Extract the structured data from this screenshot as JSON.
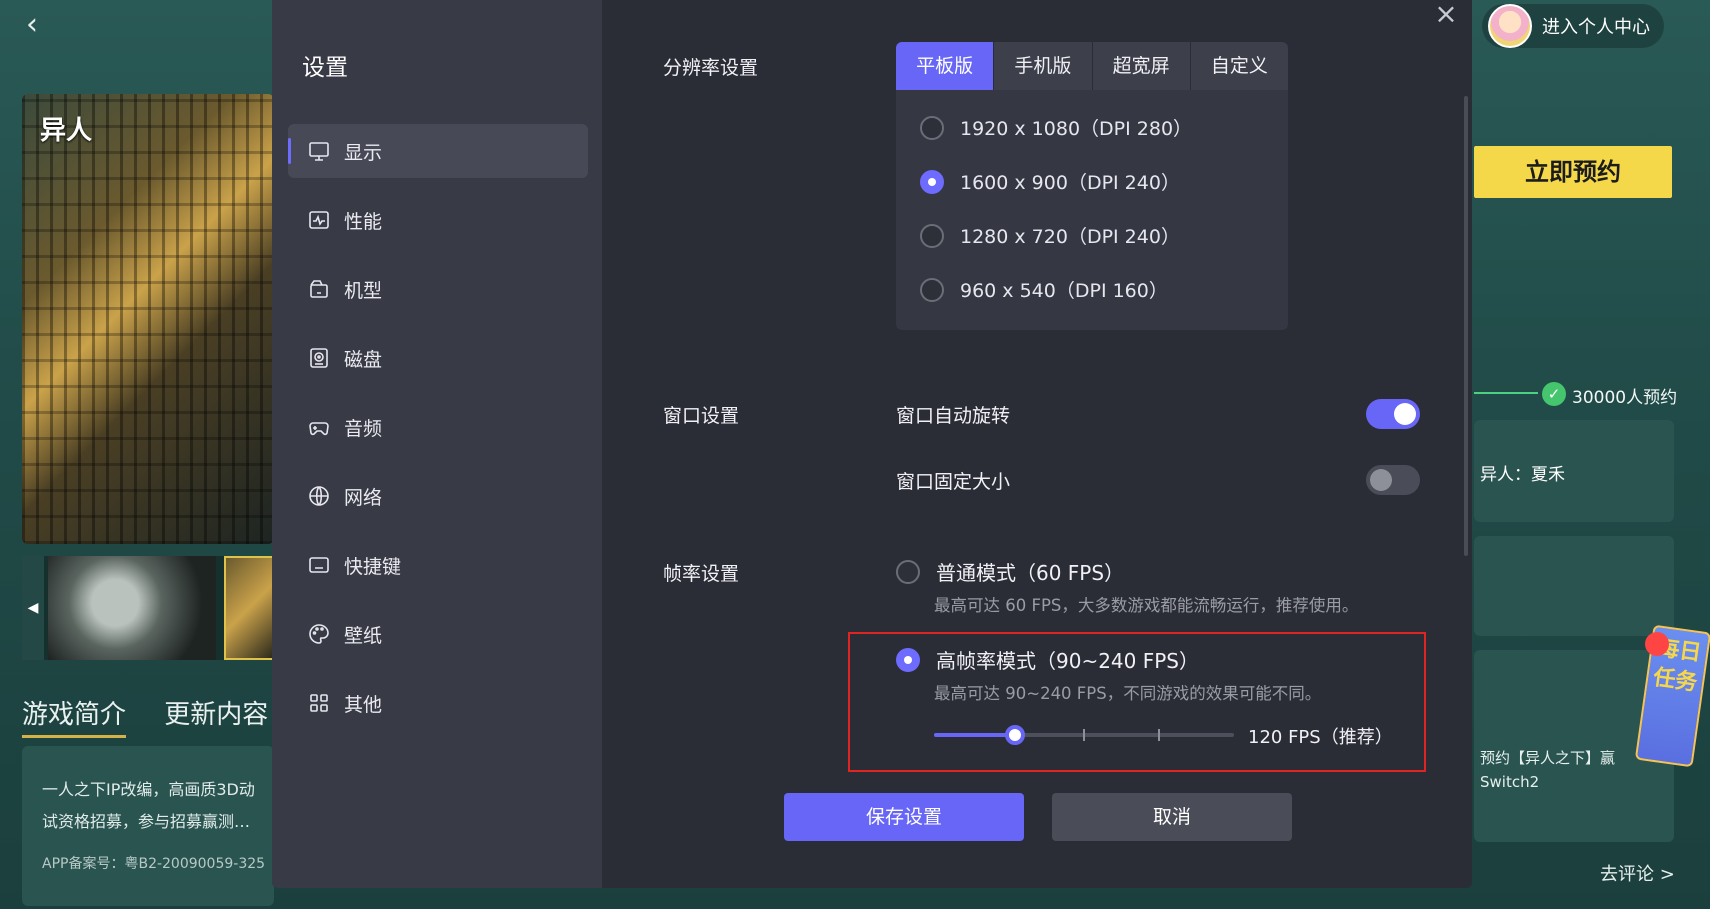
{
  "background": {
    "back_icon": "chevron-left-icon",
    "hero_logo": "异人",
    "intro_tabs": [
      "游戏简介",
      "更新内容"
    ],
    "intro_text_line1": "一人之下IP改编，高画质3D动",
    "intro_text_line2": "试资格招募，参与招募赢测…",
    "intro_license": "APP备案号：粤B2-20090059-325",
    "user_center": "进入个人中心",
    "reserve_button": "立即预约",
    "reserve_count": "30000人预约",
    "panel_r1_text": "异人：夏禾",
    "panel_r3_line1": "预约【异人之下】赢",
    "panel_r3_line2": "Switch2",
    "daily_task": "每日任务",
    "comment_link": "去评论 >"
  },
  "dialog": {
    "title": "设置",
    "close_icon": "close-icon",
    "nav": [
      {
        "label": "显示",
        "icon": "monitor-icon",
        "active": true
      },
      {
        "label": "性能",
        "icon": "performance-icon",
        "active": false
      },
      {
        "label": "机型",
        "icon": "device-icon",
        "active": false
      },
      {
        "label": "磁盘",
        "icon": "disk-icon",
        "active": false
      },
      {
        "label": "音频",
        "icon": "gamepad-icon",
        "active": false
      },
      {
        "label": "网络",
        "icon": "globe-icon",
        "active": false
      },
      {
        "label": "快捷键",
        "icon": "keyboard-icon",
        "active": false
      },
      {
        "label": "壁纸",
        "icon": "palette-icon",
        "active": false
      },
      {
        "label": "其他",
        "icon": "grid-icon",
        "active": false
      }
    ],
    "resolution": {
      "label": "分辨率设置",
      "tabs": [
        "平板版",
        "手机版",
        "超宽屏",
        "自定义"
      ],
      "active_tab": "平板版",
      "options": [
        "1920 x 1080（DPI 280）",
        "1600 x 900（DPI 240）",
        "1280 x 720（DPI 240）",
        "960 x 540（DPI 160）"
      ],
      "selected": "1600 x 900（DPI 240）"
    },
    "window": {
      "label": "窗口设置",
      "auto_rotate": {
        "label": "窗口自动旋转",
        "on": true
      },
      "fixed_size": {
        "label": "窗口固定大小",
        "on": false
      }
    },
    "framerate": {
      "label": "帧率设置",
      "normal": {
        "label": "普通模式（60 FPS）",
        "desc": "最高可达 60 FPS，大多数游戏都能流畅运行，推荐使用。",
        "checked": false
      },
      "high": {
        "label": "高帧率模式（90~240 FPS）",
        "desc": "最高可达 90~240 FPS，不同游戏的效果可能不同。",
        "checked": true
      },
      "slider_value_label": "120 FPS（推荐）",
      "slider_fraction": 0.27
    },
    "buttons": {
      "save": "保存设置",
      "cancel": "取消"
    },
    "accent_color": "#6766f7",
    "highlight_color": "#e02424"
  }
}
